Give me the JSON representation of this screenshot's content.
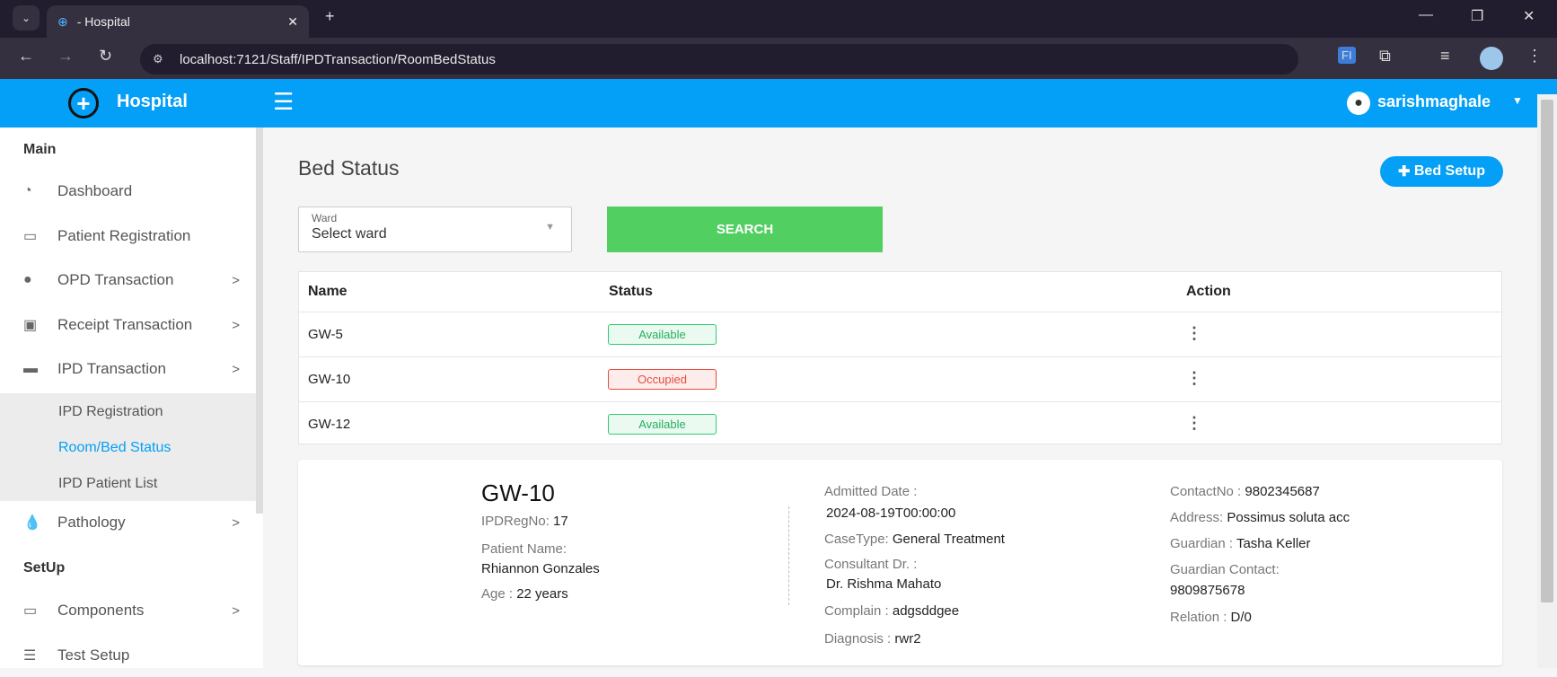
{
  "browser": {
    "tab_title": "- Hospital",
    "url": "localhost:7121/Staff/IPDTransaction/RoomBedStatus"
  },
  "header": {
    "brand": "Hospital",
    "user": "sarishmaghale"
  },
  "sidebar": {
    "section_main": "Main",
    "items": [
      {
        "label": "Dashboard",
        "icon": "gauge-icon",
        "chev": false
      },
      {
        "label": "Patient Registration",
        "icon": "id-card-icon",
        "chev": false
      },
      {
        "label": "OPD Transaction",
        "icon": "user-icon",
        "chev": true
      },
      {
        "label": "Receipt Transaction",
        "icon": "money-icon",
        "chev": true
      },
      {
        "label": "IPD Transaction",
        "icon": "bed-icon",
        "chev": true
      }
    ],
    "submenu": [
      "IPD Registration",
      "Room/Bed Status",
      "IPD Patient List"
    ],
    "pathology": "Pathology",
    "section_setup": "SetUp",
    "components": "Components",
    "test_setup": "Test Setup",
    "active_color": "#049ff6"
  },
  "main": {
    "title": "Bed Status",
    "bed_setup_label": "Bed Setup",
    "ward_label": "Ward",
    "ward_value": "Select ward",
    "search_label": "SEARCH",
    "columns": [
      "Name",
      "Status",
      "Action"
    ],
    "rows": [
      {
        "name": "GW-5",
        "status": "Available"
      },
      {
        "name": "GW-10",
        "status": "Occupied"
      },
      {
        "name": "GW-12",
        "status": "Available"
      }
    ]
  },
  "detail": {
    "bed": "GW-10",
    "ipdregno_label": "IPDRegNo:",
    "ipdregno": "17",
    "patient_label": "Patient Name:",
    "patient": "Rhiannon Gonzales",
    "age_label": "Age :",
    "age": "22 years",
    "admitted_label": "Admitted Date :",
    "admitted": "2024-08-19T00:00:00",
    "casetype_label": "CaseType:",
    "casetype": "General Treatment",
    "consultant_label": "Consultant Dr. :",
    "consultant": "Dr. Rishma Mahato",
    "complain_label": "Complain :",
    "complain": "adgsddgee",
    "diagnosis_label": "Diagnosis :",
    "diagnosis": "rwr2",
    "contact_label": "ContactNo :",
    "contact": "9802345687",
    "address_label": "Address:",
    "address": "Possimus soluta acc",
    "guardian_label": "Guardian :",
    "guardian": "Tasha Keller",
    "gcontact_label": "Guardian Contact:",
    "gcontact": "9809875678",
    "relation_label": "Relation :",
    "relation": "D/0"
  }
}
